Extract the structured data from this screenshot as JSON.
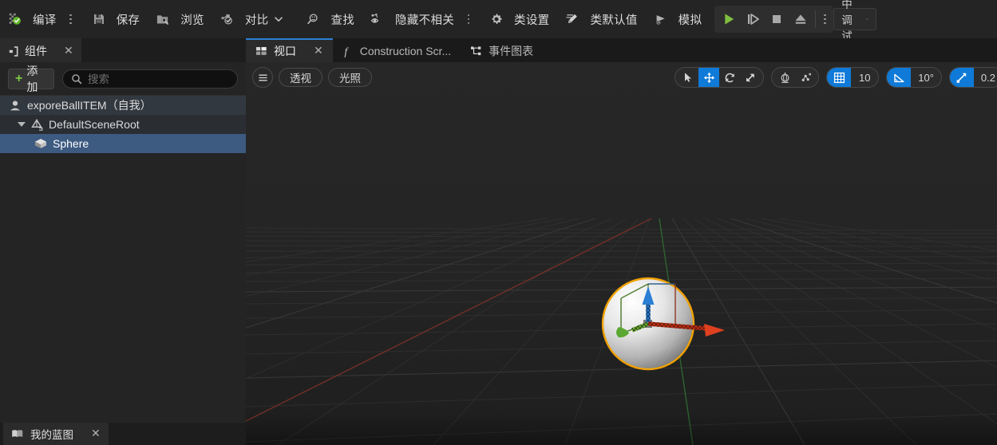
{
  "toolbar": {
    "compile_label": "编译",
    "save_label": "保存",
    "browse_label": "浏览",
    "diff_label": "对比",
    "find_label": "查找",
    "hide_unrelated_label": "隐藏不相关",
    "class_settings_label": "类设置",
    "class_defaults_label": "类默认值",
    "simulate_label": "模拟",
    "play_icon": "play-icon",
    "step_icon": "step-icon",
    "stop_icon": "stop-icon",
    "eject_icon": "eject-icon",
    "debug_object_label": "未选中调试对象",
    "accent_green": "#7ac943",
    "accent_blue": "#0f7ad8"
  },
  "components_panel": {
    "tab_label": "组件",
    "tab_icon": "components-icon",
    "close_icon": "close-icon",
    "add_label": "添加",
    "search": {
      "placeholder": "搜索",
      "value": "",
      "icon": "search-icon"
    },
    "tree": [
      {
        "label": "exporeBallITEM（自我）",
        "level": 0,
        "icon": "actor-icon",
        "selected": false,
        "expandable": false
      },
      {
        "label": "DefaultSceneRoot",
        "level": 1,
        "icon": "scene-root-icon",
        "selected": false,
        "expandable": true
      },
      {
        "label": "Sphere",
        "level": 2,
        "icon": "static-mesh-icon",
        "selected": true,
        "expandable": false
      }
    ],
    "bottom_tab_label": "我的蓝图",
    "bottom_tab_icon": "blueprint-book-icon"
  },
  "viewport": {
    "tabs": [
      {
        "label": "视口",
        "icon": "viewport-icon",
        "active": true,
        "closable": true
      },
      {
        "label": "Construction Scr...",
        "icon": "function-icon",
        "active": false,
        "closable": false
      },
      {
        "label": "事件图表",
        "icon": "event-graph-icon",
        "active": false,
        "closable": false
      }
    ],
    "overlay_left": [
      {
        "label": "",
        "icon": "hamburger-icon",
        "name": "viewport-menu-button"
      },
      {
        "label": "透视",
        "icon": "",
        "name": "view-perspective-button"
      },
      {
        "label": "光照",
        "icon": "",
        "name": "view-lit-button"
      }
    ],
    "gizmo_tools": [
      {
        "name": "select-tool",
        "icon": "cursor-icon",
        "active": false
      },
      {
        "name": "translate-tool",
        "icon": "move-icon",
        "active": true
      },
      {
        "name": "rotate-tool",
        "icon": "rotate-icon",
        "active": false
      },
      {
        "name": "scale-tool",
        "icon": "scale-icon",
        "active": false
      }
    ],
    "coord_tools": [
      {
        "name": "world-space-toggle",
        "icon": "globe-gizmo-icon",
        "active": false
      },
      {
        "name": "surface-snap-toggle",
        "icon": "surface-snap-icon",
        "active": false
      }
    ],
    "grid_snap": {
      "icon": "grid-icon",
      "value": "10",
      "enabled": true
    },
    "angle_snap": {
      "icon": "angle-icon",
      "value": "10°",
      "enabled": true
    },
    "scale_snap": {
      "icon": "scale-snap-icon",
      "value": "0.2",
      "enabled": true
    },
    "scene": {
      "selected_object": "Sphere",
      "selection_outline_color": "#f0a000",
      "gizmo_x_color": "#e04020",
      "gizmo_y_color": "#5aa832",
      "gizmo_z_color": "#2a7fd4",
      "background_color": "#232323",
      "grid_x_axis_color": "#8a3030",
      "grid_y_axis_color": "#2f7030"
    }
  }
}
